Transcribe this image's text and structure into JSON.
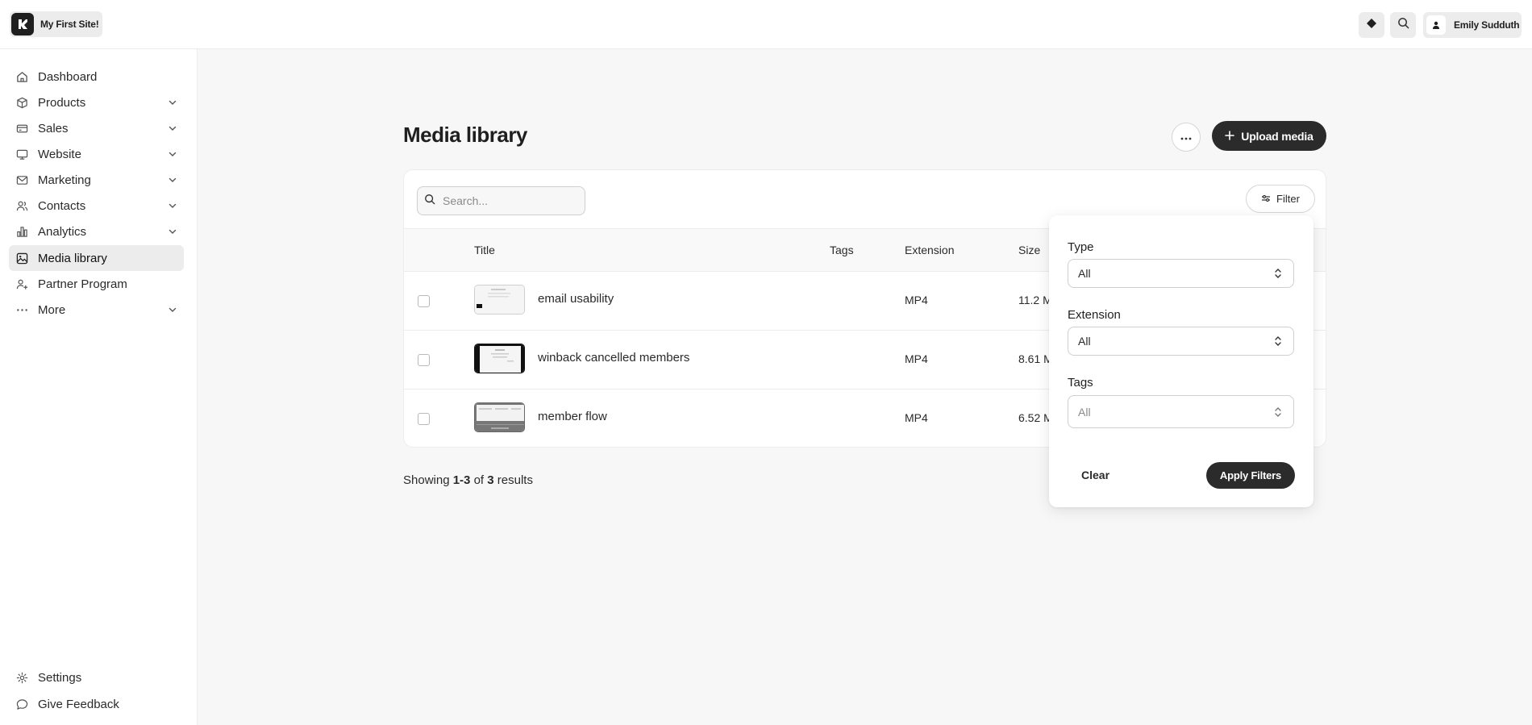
{
  "topbar": {
    "site_name": "My First Site!",
    "user_name": "Emily Sudduth"
  },
  "sidebar": {
    "items": [
      {
        "label": "Dashboard",
        "icon": "home-icon",
        "has_chevron": false
      },
      {
        "label": "Products",
        "icon": "box-icon",
        "has_chevron": true
      },
      {
        "label": "Sales",
        "icon": "credit-card-icon",
        "has_chevron": true
      },
      {
        "label": "Website",
        "icon": "monitor-icon",
        "has_chevron": true
      },
      {
        "label": "Marketing",
        "icon": "mail-icon",
        "has_chevron": true
      },
      {
        "label": "Contacts",
        "icon": "users-icon",
        "has_chevron": true
      },
      {
        "label": "Analytics",
        "icon": "bar-chart-icon",
        "has_chevron": true
      },
      {
        "label": "Media library",
        "icon": "image-icon",
        "has_chevron": false,
        "active": true
      },
      {
        "label": "Partner Program",
        "icon": "user-plus-icon",
        "has_chevron": false
      },
      {
        "label": "More",
        "icon": "ellipsis-icon",
        "has_chevron": true
      }
    ],
    "bottom": [
      {
        "label": "Settings",
        "icon": "gear-icon"
      },
      {
        "label": "Give Feedback",
        "icon": "chat-bubble-icon"
      }
    ]
  },
  "main": {
    "title": "Media library",
    "upload_label": "Upload media",
    "search_placeholder": "Search...",
    "filter_label": "Filter",
    "columns": [
      "Title",
      "Tags",
      "Extension",
      "Size"
    ],
    "rows": [
      {
        "title": "email usability",
        "tags": "",
        "extension": "MP4",
        "size": "11.2 M"
      },
      {
        "title": "winback cancelled members",
        "tags": "",
        "extension": "MP4",
        "size": "8.61 M"
      },
      {
        "title": "member flow",
        "tags": "",
        "extension": "MP4",
        "size": "6.52 M"
      }
    ],
    "results": {
      "prefix": "Showing",
      "range": "1-3",
      "of": "of",
      "total": "3",
      "suffix": "results"
    }
  },
  "filter_panel": {
    "type_label": "Type",
    "type_value": "All",
    "extension_label": "Extension",
    "extension_value": "All",
    "tags_label": "Tags",
    "tags_placeholder": "All",
    "clear_label": "Clear",
    "apply_label": "Apply Filters"
  },
  "colors": {
    "primary_dark": "#2b2b2b",
    "active_nav_bg": "#ececec",
    "page_bg": "#f7f7f7"
  }
}
